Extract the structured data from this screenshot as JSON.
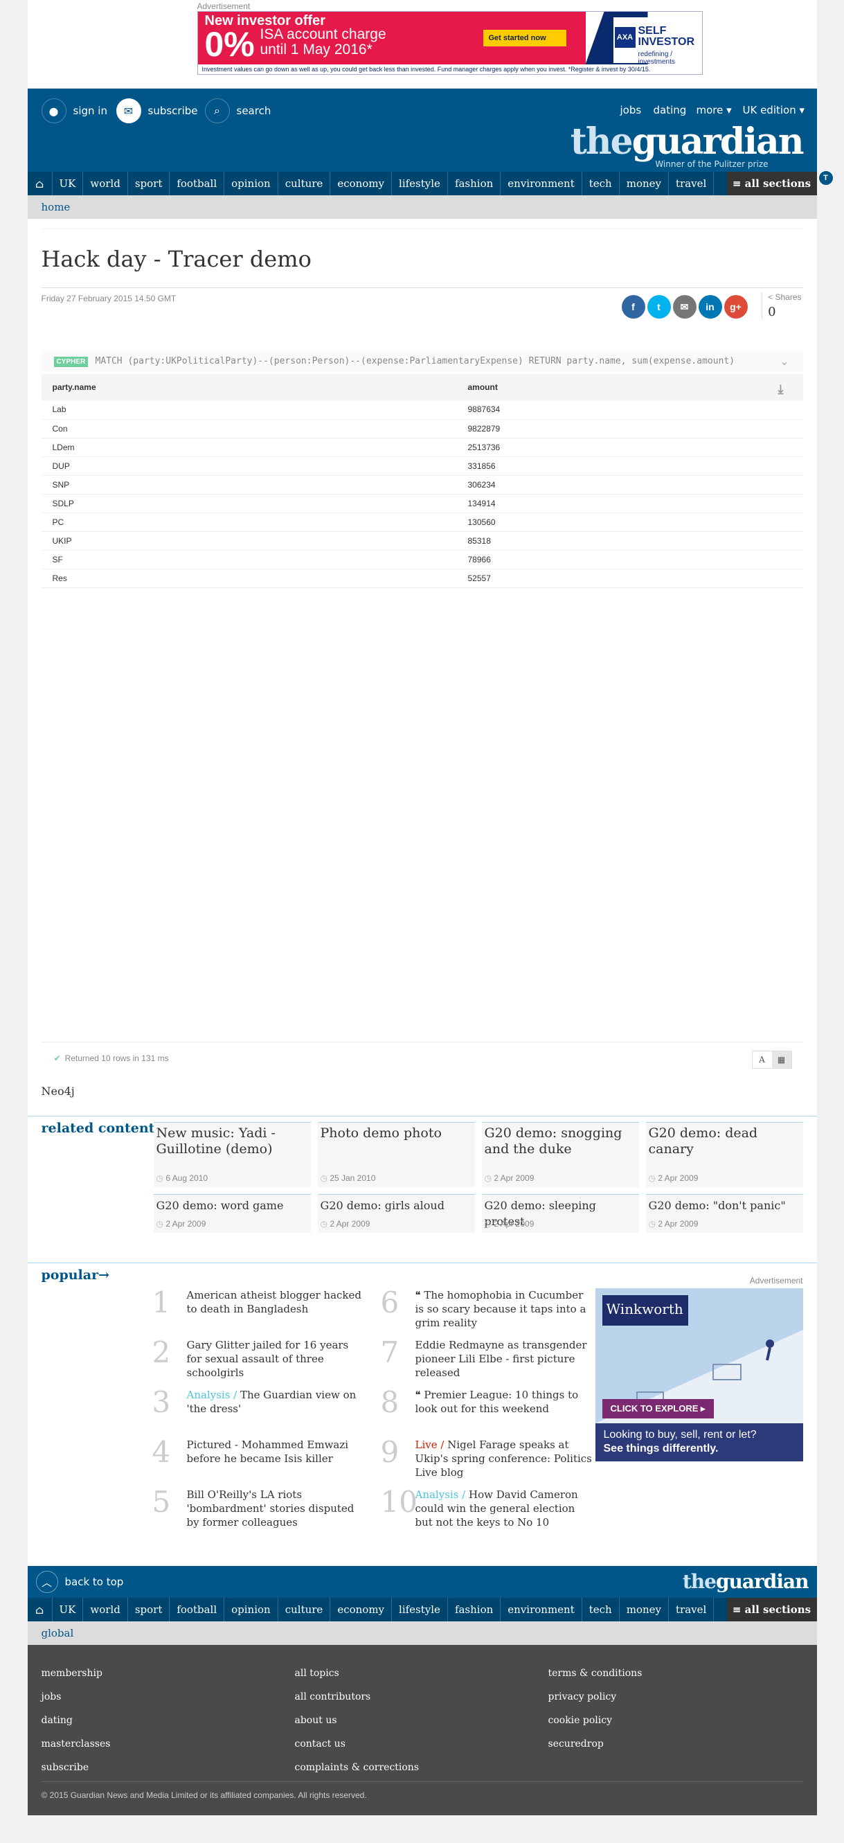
{
  "ad_top": {
    "label": "Advertisement",
    "headline": "New investor offer",
    "big": "0%",
    "line1": "ISA account charge",
    "line2": "until 1 May 2016*",
    "button": "Get started now",
    "brand1": "SELF",
    "brand2": "INVESTOR",
    "brand_tag": "redefining / investments",
    "fine": "Investment values can go down as well as up, you could get back less than invested. Fund manager charges apply when you invest. *Register & invest by 30/4/15."
  },
  "header": {
    "sign_in": "sign in",
    "subscribe": "subscribe",
    "search": "search",
    "jobs": "jobs",
    "dating": "dating",
    "more": "more ▾",
    "edition": "UK edition ▾",
    "logo_the": "the",
    "logo_main": "guardian",
    "logo_sub": "Winner of the Pulitzer prize"
  },
  "nav": {
    "items": [
      "UK",
      "world",
      "sport",
      "football",
      "opinion",
      "culture",
      "economy",
      "lifestyle",
      "fashion",
      "environment",
      "tech",
      "money",
      "travel"
    ],
    "all_sections": "≡ all sections"
  },
  "subnav": {
    "label": "home"
  },
  "article": {
    "title": "Hack day - Tracer demo",
    "date": "Friday 27 February 2015 14.50 GMT",
    "shares_label": "< Shares",
    "shares_count": "0"
  },
  "query": {
    "tag": "CYPHER",
    "text": "MATCH (party:UKPoliticalParty)--(person:Person)--(expense:ParliamentaryExpense) RETURN party.name, sum(expense.amount)"
  },
  "table": {
    "headers": [
      "party.name",
      "amount"
    ],
    "rows": [
      [
        "Lab",
        "9887634"
      ],
      [
        "Con",
        "9822879"
      ],
      [
        "LDem",
        "2513736"
      ],
      [
        "DUP",
        "331856"
      ],
      [
        "SNP",
        "306234"
      ],
      [
        "SDLP",
        "134914"
      ],
      [
        "PC",
        "130560"
      ],
      [
        "UKIP",
        "85318"
      ],
      [
        "SF",
        "78966"
      ],
      [
        "Res",
        "52557"
      ]
    ],
    "status": "Returned 10 rows in 131 ms"
  },
  "neo": "Neo4j",
  "related": {
    "heading": "related content",
    "big": [
      {
        "title": "New music: Yadi - Guillotine (demo)",
        "date": "6 Aug 2010"
      },
      {
        "title": "Photo demo photo",
        "date": "25 Jan 2010"
      },
      {
        "title": "G20 demo: snogging and the duke",
        "date": "2 Apr 2009"
      },
      {
        "title": "G20 demo: dead canary",
        "date": "2 Apr 2009"
      }
    ],
    "small": [
      {
        "title": "G20 demo: word game",
        "date": "2 Apr 2009"
      },
      {
        "title": "G20 demo: girls aloud",
        "date": "2 Apr 2009"
      },
      {
        "title": "G20 demo: sleeping protest",
        "date": "2 Apr 2009"
      },
      {
        "title": "G20 demo: \"don't panic\"",
        "date": "2 Apr 2009"
      }
    ]
  },
  "popular": {
    "heading": "popular→",
    "items": [
      {
        "num": "1",
        "kicker": "",
        "text": "American atheist blogger hacked to death in Bangladesh"
      },
      {
        "num": "2",
        "kicker": "",
        "text": "Gary Glitter jailed for 16 years for sexual assault of three schoolgirls"
      },
      {
        "num": "3",
        "kicker": "Analysis / ",
        "text": "The Guardian view on 'the dress'"
      },
      {
        "num": "4",
        "kicker": "",
        "text": "Pictured - Mohammed Emwazi before he became Isis killer"
      },
      {
        "num": "5",
        "kicker": "",
        "text": "Bill O'Reilly's LA riots 'bombardment' stories disputed by former colleagues"
      },
      {
        "num": "6",
        "kicker": "",
        "text": "❝ The homophobia in Cucumber is so scary because it taps into a grim reality"
      },
      {
        "num": "7",
        "kicker": "",
        "text": "Eddie Redmayne as transgender pioneer Lili Elbe - first picture released"
      },
      {
        "num": "8",
        "kicker": "",
        "text": "❝ Premier League: 10 things to look out for this weekend"
      },
      {
        "num": "9",
        "kicker": "Live / ",
        "text": "Nigel Farage speaks at Ukip's spring conference: Politics Live blog"
      },
      {
        "num": "10",
        "kicker": "Analysis / ",
        "text": "How David Cameron could win the general election but not the keys to No 10"
      }
    ]
  },
  "ad_side": {
    "label": "Advertisement",
    "brand": "Winkworth",
    "cta": "CLICK TO EXPLORE ▸",
    "line1": "Looking to buy, sell, rent or let?",
    "line2": "See things differently."
  },
  "footer": {
    "back_to_top": "back to top",
    "logo_the": "the",
    "logo_main": "guardian",
    "edition": "global",
    "col1": [
      "membership",
      "jobs",
      "dating",
      "masterclasses",
      "subscribe"
    ],
    "col2": [
      "all topics",
      "all contributors",
      "about us",
      "contact us",
      "complaints & corrections"
    ],
    "col3": [
      "terms & conditions",
      "privacy policy",
      "cookie policy",
      "securedrop"
    ],
    "copyright": "© 2015 Guardian News and Media Limited or its affiliated companies. All rights reserved."
  },
  "colors": {
    "brand": "#005689",
    "nav": "#00456e",
    "accent": "#4bc6df",
    "live": "#d61d00",
    "cypher": "#6dce9e"
  }
}
